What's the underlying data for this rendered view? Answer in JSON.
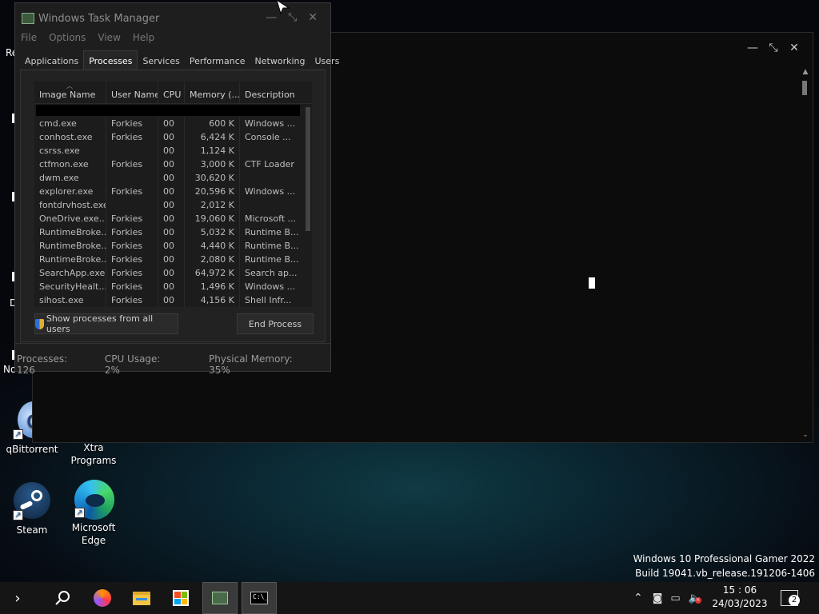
{
  "desktop": {
    "icons": [
      {
        "label": "qBittorrent"
      },
      {
        "label": "Xtra Programs"
      },
      {
        "label": "Steam"
      },
      {
        "label": "Microsoft Edge"
      }
    ],
    "edge_fragments": {
      "top": "Re",
      "mid": "D",
      "bottom": "No"
    }
  },
  "task_manager": {
    "title": "Windows Task Manager",
    "menu": [
      "File",
      "Options",
      "View",
      "Help"
    ],
    "tabs": [
      "Applications",
      "Processes",
      "Services",
      "Performance",
      "Networking",
      "Users"
    ],
    "active_tab": "Processes",
    "columns": [
      "Image Name",
      "User Name",
      "CPU",
      "Memory (...",
      "Description"
    ],
    "rows": [
      {
        "name": "cmd.exe",
        "user": "Forkies",
        "cpu": "00",
        "mem": "600 K",
        "desc": "Windows ..."
      },
      {
        "name": "conhost.exe",
        "user": "Forkies",
        "cpu": "00",
        "mem": "6,424 K",
        "desc": "Console ..."
      },
      {
        "name": "csrss.exe",
        "user": "",
        "cpu": "00",
        "mem": "1,124 K",
        "desc": ""
      },
      {
        "name": "ctfmon.exe",
        "user": "Forkies",
        "cpu": "00",
        "mem": "3,000 K",
        "desc": "CTF Loader"
      },
      {
        "name": "dwm.exe",
        "user": "",
        "cpu": "00",
        "mem": "30,620 K",
        "desc": ""
      },
      {
        "name": "explorer.exe",
        "user": "Forkies",
        "cpu": "00",
        "mem": "20,596 K",
        "desc": "Windows ..."
      },
      {
        "name": "fontdrvhost.exe",
        "user": "",
        "cpu": "00",
        "mem": "2,012 K",
        "desc": ""
      },
      {
        "name": "OneDrive.exe...",
        "user": "Forkies",
        "cpu": "00",
        "mem": "19,060 K",
        "desc": "Microsoft ..."
      },
      {
        "name": "RuntimeBroke...",
        "user": "Forkies",
        "cpu": "00",
        "mem": "5,032 K",
        "desc": "Runtime B..."
      },
      {
        "name": "RuntimeBroke...",
        "user": "Forkies",
        "cpu": "00",
        "mem": "4,440 K",
        "desc": "Runtime B..."
      },
      {
        "name": "RuntimeBroke...",
        "user": "Forkies",
        "cpu": "00",
        "mem": "2,080 K",
        "desc": "Runtime B..."
      },
      {
        "name": "SearchApp.exe",
        "user": "Forkies",
        "cpu": "00",
        "mem": "64,972 K",
        "desc": "Search ap..."
      },
      {
        "name": "SecurityHealt...",
        "user": "Forkies",
        "cpu": "00",
        "mem": "1,496 K",
        "desc": "Windows ..."
      },
      {
        "name": "sihost.exe",
        "user": "Forkies",
        "cpu": "00",
        "mem": "4,156 K",
        "desc": "Shell Infr..."
      }
    ],
    "show_all_label": "Show processes from all users",
    "end_process_label": "End Process",
    "status": {
      "processes": "Processes: 126",
      "cpu": "CPU Usage: 2%",
      "memory": "Physical Memory: 35%"
    }
  },
  "watermark": {
    "line1": "Windows 10 Professional Gamer 2022",
    "line2": "Build 19041.vb_release.191206-1406"
  },
  "taskbar": {
    "clock_time": "15 : 06",
    "clock_date": "24/03/2023",
    "notification_count": "2"
  }
}
